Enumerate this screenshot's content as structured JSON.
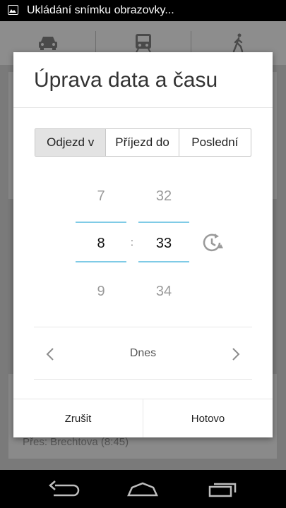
{
  "status_bar": {
    "notification_text": "Ukládání snímku obrazovky..."
  },
  "background": {
    "tabs": [
      {
        "icon": "car-icon"
      },
      {
        "icon": "train-icon"
      },
      {
        "icon": "walk-icon"
      }
    ],
    "bottom_card_text": "Přes: Brechtova (8:45)"
  },
  "dialog": {
    "title": "Úprava data a času",
    "mode_options": [
      {
        "label": "Odjezd v",
        "selected": true
      },
      {
        "label": "Příjezd do",
        "selected": false
      },
      {
        "label": "Poslední",
        "selected": false
      }
    ],
    "time_picker": {
      "hour_prev": "7",
      "hour_current": "8",
      "hour_next": "9",
      "separator": ":",
      "minute_prev": "32",
      "minute_current": "33",
      "minute_next": "34",
      "reset_icon": "reset-time-icon",
      "accent_color": "#7fcbe6"
    },
    "date_picker": {
      "label": "Dnes",
      "prev_icon": "chevron-left-icon",
      "next_icon": "chevron-right-icon"
    },
    "buttons": {
      "cancel_label": "Zrušit",
      "confirm_label": "Hotovo"
    }
  },
  "nav_bar": {
    "icons": [
      "back-icon",
      "home-icon",
      "recents-icon"
    ]
  }
}
